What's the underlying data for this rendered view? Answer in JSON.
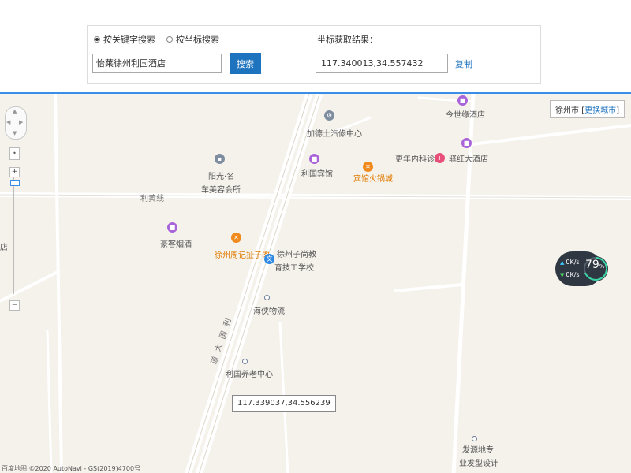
{
  "search_panel": {
    "radio_keyword_label": "按关键字搜索",
    "radio_coord_label": "按坐标搜索",
    "search_value": "怡莱徐州利国酒店",
    "search_button_label": "搜索",
    "coord_result_label": "坐标获取结果：",
    "coord_result_value": "117.340013,34.557432",
    "copy_label": "复制"
  },
  "map": {
    "city_box": {
      "city": "徐州市",
      "change_label": "更换城市",
      "open_bracket": "[",
      "close_bracket": "]"
    },
    "pois": {
      "auto_repair": "加德士汽修中心",
      "hotel_jinshi": "今世缘酒店",
      "clinic": "更年内科诊所",
      "hotel_yihong": "驿红大酒店",
      "liguo_hotel": "利国宾馆",
      "hotpot": "宾馆火锅城",
      "beauty_line1": "阳光·名",
      "beauty_line2": "车美容会所",
      "tobacco": "豪客烟酒",
      "rabbit": "徐州周记扯子肉",
      "school_line1": "徐州子尚教",
      "school_line2": "育技工学校",
      "logistics": "海侠物流",
      "elderly": "利国养老中心",
      "hairdesign_line1": "发源地专",
      "hairdesign_line2": "业发型设计",
      "edge_hotel": "店"
    },
    "roads": {
      "liguo_line": "利黄线",
      "avenue_part1": "利",
      "avenue_part2": "国",
      "avenue_part3": "大",
      "avenue_part4": "道"
    },
    "map_coord_tooltip": "117.339037,34.556239",
    "controls": {
      "zoom_in": "+",
      "zoom_out": "−",
      "locate": "•"
    },
    "copyright": "百度地图 ©2020 AutoNavi - GS(2019)4700号"
  },
  "net_widget": {
    "upload": "0K/s",
    "download": "0K/s",
    "percent": "79",
    "percent_unit": "%"
  },
  "colors": {
    "accent": "#1e73be",
    "map_bg": "#f5f2ec",
    "poi_purple": "#a864d8",
    "poi_orange": "#f08a1c"
  }
}
